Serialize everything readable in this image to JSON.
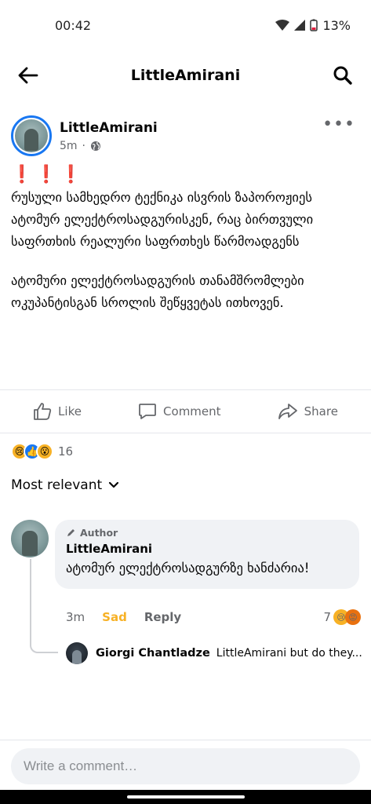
{
  "status": {
    "time": "00:42",
    "battery": "13%"
  },
  "appbar": {
    "title": "LittleAmirani",
    "back_icon": "arrow-left-icon",
    "search_icon": "search-icon"
  },
  "post": {
    "author": "LittleAmirani",
    "time": "5m",
    "privacy_icon": "globe-icon",
    "alert": "❗❗❗",
    "paragraph1": "რუსული სამხედრო ტექნიკა ისვრის ზაპოროჟიეს ატომურ ელექტროსადგურისკენ, რაც ბირთვული საფრთხის რეალური საფრთხეს წარმოადგენს",
    "paragraph2": "ატომური ელექტროსადგურის თანამშრომლები ოკუპანტისგან სროლის შეწყვეტას ითხოვენ."
  },
  "actions": {
    "like": "Like",
    "comment": "Comment",
    "share": "Share"
  },
  "reactions": {
    "emojis": [
      "😢",
      "👍",
      "😮"
    ],
    "count": "16"
  },
  "sort": {
    "label": "Most relevant"
  },
  "comment": {
    "tag": "Author",
    "name": "LittleAmirani",
    "text": "ატომურ ელექტროსადგურზე ხანძარია!",
    "time": "3m",
    "reaction_label": "Sad",
    "reply_label": "Reply",
    "reaction_count": "7",
    "reaction_emojis": [
      "😢",
      "😡"
    ]
  },
  "reply": {
    "name": "Giorgi  Chantladze",
    "text": "LittleAmirani but do they..."
  },
  "composer": {
    "placeholder": "Write a comment…"
  },
  "colors": {
    "accent": "#1877f2",
    "sad": "#f7b125",
    "alert": "#e41e3f"
  }
}
